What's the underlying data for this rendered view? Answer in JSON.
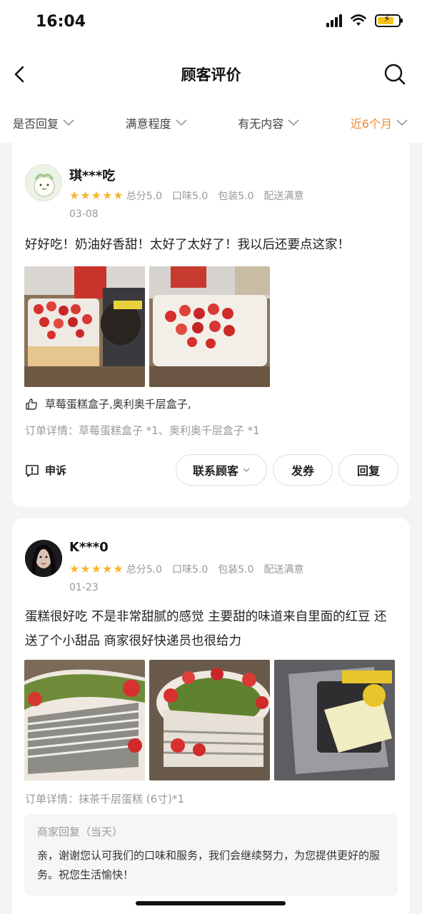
{
  "status_bar": {
    "time": "16:04"
  },
  "nav": {
    "title": "顾客评价"
  },
  "filters": [
    {
      "label": "是否回复",
      "active": false
    },
    {
      "label": "满意程度",
      "active": false
    },
    {
      "label": "有无内容",
      "active": false
    },
    {
      "label": "近6个月",
      "active": true
    }
  ],
  "colors": {
    "accent": "#f08a2c",
    "star": "#f7b52c"
  },
  "reviews": [
    {
      "username": "琪***吃",
      "stars": 5,
      "overall": "总分5.0",
      "taste": "口味5.0",
      "packaging": "包装5.0",
      "delivery": "配送满意",
      "date": "03-08",
      "text": "好好吃！奶油好香甜！太好了太好了！我以后还要点这家！",
      "liked_items": "草莓蛋糕盒子,奥利奥千层盒子,",
      "order_detail": "订单详情：草莓蛋糕盒子 *1、奥利奥千层盒子 *1",
      "complain_label": "申诉",
      "buttons": {
        "contact": "联系顾客",
        "coupon": "发券",
        "reply": "回复"
      }
    },
    {
      "username": "K***0",
      "stars": 5,
      "overall": "总分5.0",
      "taste": "口味5.0",
      "packaging": "包装5.0",
      "delivery": "配送满意",
      "date": "01-23",
      "text": "蛋糕很好吃  不是非常甜腻的感觉  主要甜的味道来自里面的红豆  还送了个小甜品  商家很好快递员也很给力",
      "order_detail": "订单详情：抹茶千层蛋糕 (6寸)*1",
      "merchant_reply": {
        "label": "商家回复（当天）",
        "text": "亲，谢谢您认可我们的口味和服务，我们会继续努力，为您提供更好的服务。祝您生活愉快！"
      }
    }
  ]
}
